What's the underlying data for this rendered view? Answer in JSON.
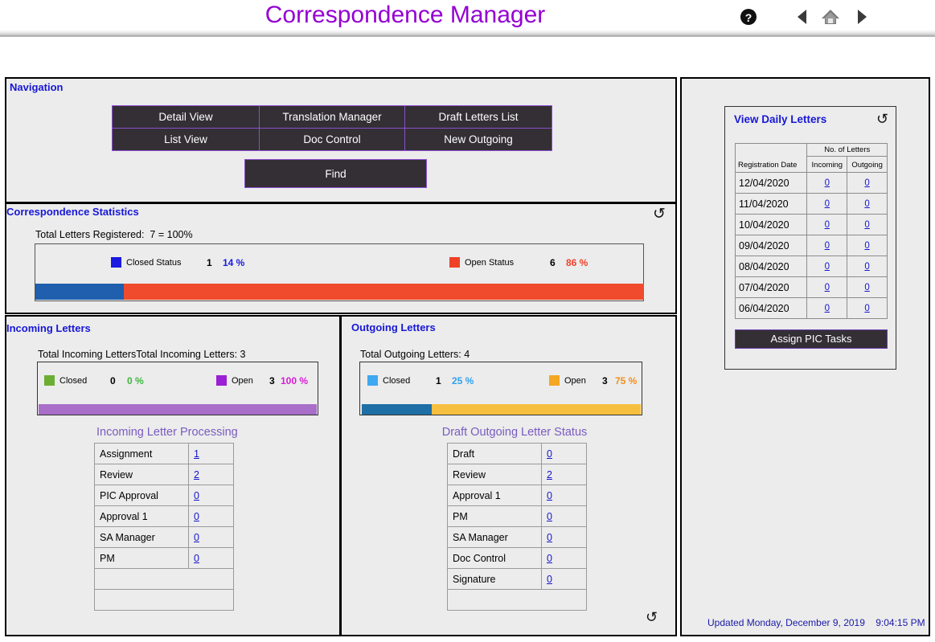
{
  "header": {
    "title": "Correspondence Manager",
    "icons": [
      {
        "name": "help-icon",
        "glyph": "?"
      },
      {
        "name": "back-arrow-icon",
        "glyph": "◀"
      },
      {
        "name": "home-icon",
        "glyph": "⌂"
      },
      {
        "name": "forward-arrow-icon",
        "glyph": "▶"
      }
    ]
  },
  "navigation": {
    "title": "Navigation",
    "buttons": [
      {
        "label": "Detail View"
      },
      {
        "label": "Translation Manager"
      },
      {
        "label": "Draft Letters List"
      },
      {
        "label": "List View"
      },
      {
        "label": "Doc Control"
      },
      {
        "label": "New Outgoing"
      }
    ],
    "find_label": "Find"
  },
  "statistics": {
    "title": "Correspondence Statistics",
    "refresh_glyph": "↺",
    "total_label": "Total Letters Registered:  7 = 100%",
    "closed": {
      "label": "Closed Status",
      "count": "1",
      "percent": "14 %",
      "color": "#1a1ae0",
      "bar_color": "#1f5fad"
    },
    "open": {
      "label": "Open Status",
      "count": "6",
      "percent": "86 %",
      "color": "#f04128",
      "bar_color": "#ef4b2c"
    }
  },
  "incoming": {
    "title": "Incoming Letters",
    "total_label": "Total Incoming LettersTotal Incoming Letters:  3",
    "closed": {
      "label": "Closed",
      "count": "0",
      "percent": "0 %",
      "color": "#3fb63f",
      "swatch": "#6aaf32"
    },
    "open": {
      "label": "Open",
      "count": "3",
      "percent": "100 %",
      "color": "#d81ad8",
      "swatch": "#9b1fd4",
      "bar_color": "#a96ec8"
    },
    "subtable_title": "Incoming Letter Processing",
    "rows": [
      {
        "label": "Assignment",
        "value": "1"
      },
      {
        "label": "Review",
        "value": "2"
      },
      {
        "label": "PIC Approval",
        "value": "0"
      },
      {
        "label": "Approval 1",
        "value": "0"
      },
      {
        "label": "SA Manager",
        "value": "0"
      },
      {
        "label": "PM",
        "value": "0"
      },
      {
        "label": "",
        "value": ""
      },
      {
        "label": "",
        "value": ""
      }
    ]
  },
  "outgoing": {
    "title": "Outgoing Letters",
    "total_label": "Total Outgoing Letters: 4",
    "refresh_glyph": "↺",
    "closed": {
      "label": "Closed",
      "count": "1",
      "percent": "25 %",
      "color": "#2fa0ef",
      "swatch": "#3ea8f0",
      "bar_color": "#1d6fa5"
    },
    "open": {
      "label": "Open",
      "count": "3",
      "percent": "75 %",
      "color": "#f0901a",
      "swatch": "#f5a623",
      "bar_color": "#f7bf3f"
    },
    "subtable_title": "Draft Outgoing Letter Status",
    "rows": [
      {
        "label": "Draft",
        "value": "0"
      },
      {
        "label": "Review",
        "value": "2"
      },
      {
        "label": "Approval 1",
        "value": "0"
      },
      {
        "label": "PM",
        "value": "0"
      },
      {
        "label": "SA Manager",
        "value": "0"
      },
      {
        "label": "Doc Control",
        "value": "0"
      },
      {
        "label": "Signature",
        "value": "0"
      },
      {
        "label": "",
        "value": ""
      }
    ]
  },
  "daily": {
    "title": "View Daily Letters",
    "refresh_glyph": "↺",
    "header_date": "Registration Date",
    "header_group": "No. of Letters",
    "header_incoming": "Incoming",
    "header_outgoing": "Outgoing",
    "rows": [
      {
        "date": "12/04/2020",
        "incoming": "0",
        "outgoing": "0"
      },
      {
        "date": "11/04/2020",
        "incoming": "0",
        "outgoing": "0"
      },
      {
        "date": "10/04/2020",
        "incoming": "0",
        "outgoing": "0"
      },
      {
        "date": "09/04/2020",
        "incoming": "0",
        "outgoing": "0"
      },
      {
        "date": "08/04/2020",
        "incoming": "0",
        "outgoing": "0"
      },
      {
        "date": "07/04/2020",
        "incoming": "0",
        "outgoing": "0"
      },
      {
        "date": "06/04/2020",
        "incoming": "0",
        "outgoing": "0"
      }
    ],
    "assign_label": "Assign PIC Tasks"
  },
  "footer": {
    "updated": "Updated Monday, December 9, 2019    9:04:15 PM"
  },
  "chart_data": [
    {
      "type": "bar",
      "title": "Correspondence Statistics",
      "subtitle": "Total Letters Registered:  7 = 100%",
      "orientation": "horizontal-stacked",
      "categories": [
        "Closed Status",
        "Open Status"
      ],
      "values": [
        1,
        6
      ],
      "percents": [
        14,
        86
      ],
      "colors": [
        "#1f5fad",
        "#ef4b2c"
      ],
      "total": 7
    },
    {
      "type": "bar",
      "title": "Incoming Letters",
      "subtitle": "Total Incoming Letters:  3",
      "orientation": "horizontal-stacked",
      "categories": [
        "Closed",
        "Open"
      ],
      "values": [
        0,
        3
      ],
      "percents": [
        0,
        100
      ],
      "colors": [
        "#6aaf32",
        "#a96ec8"
      ],
      "total": 3
    },
    {
      "type": "bar",
      "title": "Outgoing Letters",
      "subtitle": "Total Outgoing Letters: 4",
      "orientation": "horizontal-stacked",
      "categories": [
        "Closed",
        "Open"
      ],
      "values": [
        1,
        3
      ],
      "percents": [
        25,
        75
      ],
      "colors": [
        "#1d6fa5",
        "#f7bf3f"
      ],
      "total": 4
    },
    {
      "type": "table",
      "title": "Incoming Letter Processing",
      "categories": [
        "Assignment",
        "Review",
        "PIC Approval",
        "Approval 1",
        "SA Manager",
        "PM"
      ],
      "values": [
        1,
        2,
        0,
        0,
        0,
        0
      ]
    },
    {
      "type": "table",
      "title": "Draft Outgoing Letter Status",
      "categories": [
        "Draft",
        "Review",
        "Approval 1",
        "PM",
        "SA Manager",
        "Doc Control",
        "Signature"
      ],
      "values": [
        0,
        2,
        0,
        0,
        0,
        0,
        0
      ]
    }
  ]
}
